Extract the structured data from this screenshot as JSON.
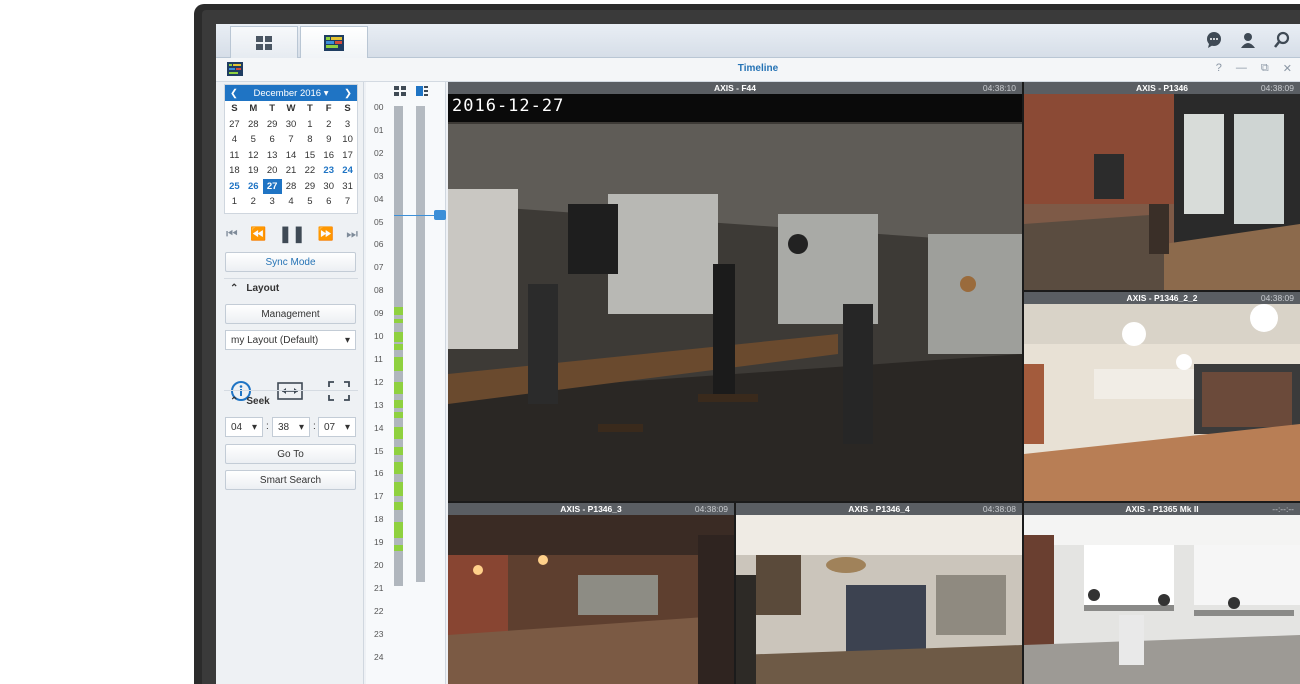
{
  "window": {
    "title": "Timeline",
    "controls": [
      "?",
      "—",
      "⧉",
      "✕"
    ]
  },
  "topbar": {
    "tabs": [
      "main-menu",
      "timeline-app"
    ],
    "right_icons": [
      "chat-icon",
      "user-icon",
      "search-icon"
    ]
  },
  "calendar": {
    "month_label": "December 2016",
    "dow": [
      "S",
      "M",
      "T",
      "W",
      "T",
      "F",
      "S"
    ],
    "weeks": [
      [
        "27",
        "28",
        "29",
        "30",
        "1",
        "2",
        "3"
      ],
      [
        "4",
        "5",
        "6",
        "7",
        "8",
        "9",
        "10"
      ],
      [
        "11",
        "12",
        "13",
        "14",
        "15",
        "16",
        "17"
      ],
      [
        "18",
        "19",
        "20",
        "21",
        "22",
        "23",
        "24"
      ],
      [
        "25",
        "26",
        "27",
        "28",
        "29",
        "30",
        "31"
      ],
      [
        "1",
        "2",
        "3",
        "4",
        "5",
        "6",
        "7"
      ]
    ],
    "recorded_days": [
      "23",
      "24",
      "25",
      "26"
    ],
    "selected_day": "27"
  },
  "controls": {
    "sync_mode": "Sync Mode",
    "layout_header": "Layout",
    "management": "Management",
    "layout_select": "my Layout (Default)",
    "seek_header": "Seek",
    "seek_hour": "04",
    "seek_minute": "38",
    "seek_second": "07",
    "goto": "Go To",
    "smart_search": "Smart Search"
  },
  "timeline": {
    "hours": [
      "00",
      "01",
      "02",
      "03",
      "04",
      "05",
      "06",
      "07",
      "08",
      "09",
      "10",
      "11",
      "12",
      "13",
      "14",
      "15",
      "16",
      "17",
      "18",
      "19",
      "20",
      "21",
      "22",
      "23",
      "24"
    ]
  },
  "cameras": [
    {
      "name": "AXIS - F44",
      "time": "04:38:10",
      "date_overlay": "2016-12-27"
    },
    {
      "name": "AXIS - P1346",
      "time": "04:38:09"
    },
    {
      "name": "AXIS - P1346_2_2",
      "time": "04:38:09"
    },
    {
      "name": "AXIS - P1346_3",
      "time": "04:38:09"
    },
    {
      "name": "AXIS - P1346_4",
      "time": "04:38:08"
    },
    {
      "name": "AXIS - P1365 Mk II",
      "time": "--:--:--"
    }
  ],
  "colors": {
    "accent": "#1f74c4",
    "recorded": "#8fd13f",
    "focus": "#e3c233"
  }
}
